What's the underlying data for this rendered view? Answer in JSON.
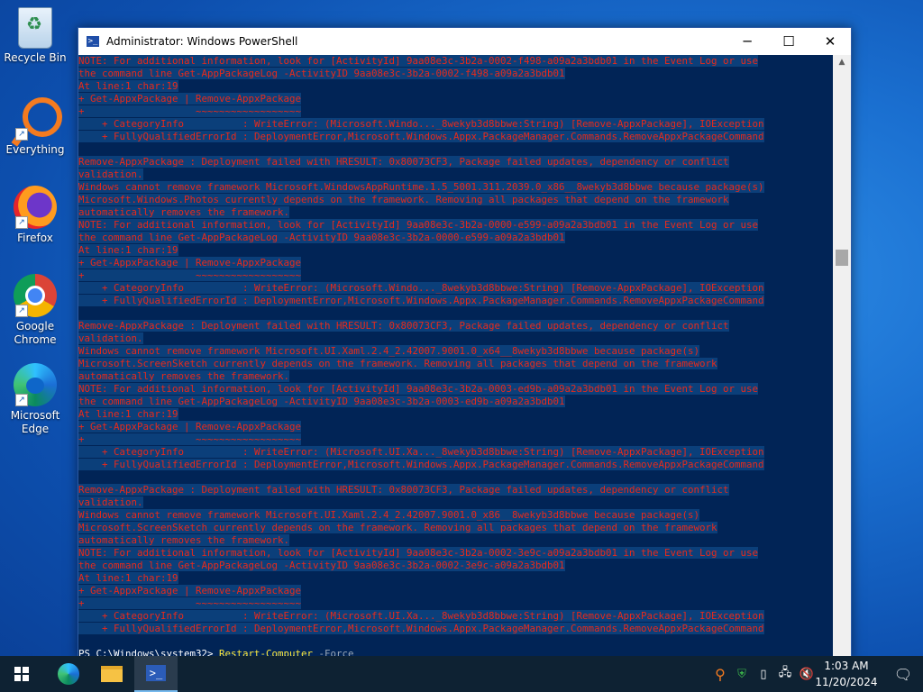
{
  "desktop": {
    "icons": [
      {
        "label": "Recycle Bin",
        "icon": "recycle-bin-icon"
      },
      {
        "label": "Everything",
        "icon": "everything-search-icon"
      },
      {
        "label": "Firefox",
        "icon": "firefox-icon"
      },
      {
        "label": "Google Chrome",
        "icon": "chrome-icon"
      },
      {
        "label": "Microsoft Edge",
        "icon": "edge-icon"
      }
    ]
  },
  "window": {
    "title": "Administrator: Windows PowerShell",
    "minimize": "─",
    "maximize": "☐",
    "close": "✕"
  },
  "console": {
    "lines": [
      "NOTE: For additional information, look for [ActivityId] 9aa08e3c-3b2a-0002-f498-a09a2a3bdb01 in the Event Log or use",
      "the command line Get-AppPackageLog -ActivityID 9aa08e3c-3b2a-0002-f498-a09a2a3bdb01",
      "At line:1 char:19",
      "+ Get-AppxPackage | Remove-AppxPackage",
      "+                   ~~~~~~~~~~~~~~~~~~",
      "    + CategoryInfo          : WriteError: (Microsoft.Windo..._8wekyb3d8bbwe:String) [Remove-AppxPackage], IOException",
      "    + FullyQualifiedErrorId : DeploymentError,Microsoft.Windows.Appx.PackageManager.Commands.RemoveAppxPackageCommand",
      "",
      "Remove-AppxPackage : Deployment failed with HRESULT: 0x80073CF3, Package failed updates, dependency or conflict",
      "validation.",
      "Windows cannot remove framework Microsoft.WindowsAppRuntime.1.5_5001.311.2039.0_x86__8wekyb3d8bbwe because package(s)",
      "Microsoft.Windows.Photos currently depends on the framework. Removing all packages that depend on the framework",
      "automatically removes the framework.",
      "NOTE: For additional information, look for [ActivityId] 9aa08e3c-3b2a-0000-e599-a09a2a3bdb01 in the Event Log or use",
      "the command line Get-AppPackageLog -ActivityID 9aa08e3c-3b2a-0000-e599-a09a2a3bdb01",
      "At line:1 char:19",
      "+ Get-AppxPackage | Remove-AppxPackage",
      "+                   ~~~~~~~~~~~~~~~~~~",
      "    + CategoryInfo          : WriteError: (Microsoft.Windo..._8wekyb3d8bbwe:String) [Remove-AppxPackage], IOException",
      "    + FullyQualifiedErrorId : DeploymentError,Microsoft.Windows.Appx.PackageManager.Commands.RemoveAppxPackageCommand",
      "",
      "Remove-AppxPackage : Deployment failed with HRESULT: 0x80073CF3, Package failed updates, dependency or conflict",
      "validation.",
      "Windows cannot remove framework Microsoft.UI.Xaml.2.4_2.42007.9001.0_x64__8wekyb3d8bbwe because package(s)",
      "Microsoft.ScreenSketch currently depends on the framework. Removing all packages that depend on the framework",
      "automatically removes the framework.",
      "NOTE: For additional information, look for [ActivityId] 9aa08e3c-3b2a-0003-ed9b-a09a2a3bdb01 in the Event Log or use",
      "the command line Get-AppPackageLog -ActivityID 9aa08e3c-3b2a-0003-ed9b-a09a2a3bdb01",
      "At line:1 char:19",
      "+ Get-AppxPackage | Remove-AppxPackage",
      "+                   ~~~~~~~~~~~~~~~~~~",
      "    + CategoryInfo          : WriteError: (Microsoft.UI.Xa..._8wekyb3d8bbwe:String) [Remove-AppxPackage], IOException",
      "    + FullyQualifiedErrorId : DeploymentError,Microsoft.Windows.Appx.PackageManager.Commands.RemoveAppxPackageCommand",
      "",
      "Remove-AppxPackage : Deployment failed with HRESULT: 0x80073CF3, Package failed updates, dependency or conflict",
      "validation.",
      "Windows cannot remove framework Microsoft.UI.Xaml.2.4_2.42007.9001.0_x86__8wekyb3d8bbwe because package(s)",
      "Microsoft.ScreenSketch currently depends on the framework. Removing all packages that depend on the framework",
      "automatically removes the framework.",
      "NOTE: For additional information, look for [ActivityId] 9aa08e3c-3b2a-0002-3e9c-a09a2a3bdb01 in the Event Log or use",
      "the command line Get-AppPackageLog -ActivityID 9aa08e3c-3b2a-0002-3e9c-a09a2a3bdb01",
      "At line:1 char:19",
      "+ Get-AppxPackage | Remove-AppxPackage",
      "+                   ~~~~~~~~~~~~~~~~~~",
      "    + CategoryInfo          : WriteError: (Microsoft.UI.Xa..._8wekyb3d8bbwe:String) [Remove-AppxPackage], IOException",
      "    + FullyQualifiedErrorId : DeploymentError,Microsoft.Windows.Appx.PackageManager.Commands.RemoveAppxPackageCommand",
      ""
    ],
    "prompt": {
      "path": "PS C:\\Windows\\system32> ",
      "command": "Restart-Computer",
      "argument": " -Force"
    },
    "colors": {
      "background": "#012456",
      "error": "#e82a1b",
      "highlight": "#0b3f7a",
      "command": "#ffeb3b"
    }
  },
  "taskbar": {
    "pinned": [
      "start-icon",
      "edge-icon",
      "file-explorer-icon",
      "powershell-icon"
    ],
    "tray_icons": [
      "everything-tray-icon",
      "defender-icon",
      "usb-icon",
      "network-icon",
      "volume-muted-icon"
    ],
    "time": "1:03 AM",
    "date": "11/20/2024"
  }
}
